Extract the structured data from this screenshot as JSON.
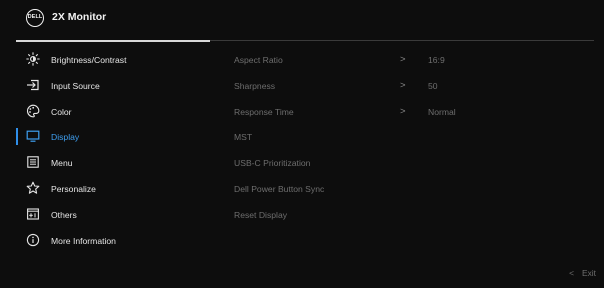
{
  "header": {
    "logo_text": "DELL",
    "title": "2X Monitor"
  },
  "menu": {
    "items": [
      {
        "label": "Brightness/Contrast",
        "icon": "brightness-icon"
      },
      {
        "label": "Input Source",
        "icon": "input-source-icon"
      },
      {
        "label": "Color",
        "icon": "color-palette-icon"
      },
      {
        "label": "Display",
        "icon": "display-monitor-icon",
        "active": true
      },
      {
        "label": "Menu",
        "icon": "menu-list-icon"
      },
      {
        "label": "Personalize",
        "icon": "star-icon"
      },
      {
        "label": "Others",
        "icon": "others-icon"
      },
      {
        "label": "More Information",
        "icon": "info-icon"
      }
    ]
  },
  "submenu": {
    "items": [
      {
        "label": "Aspect Ratio",
        "has_arrow": true,
        "value": "16:9"
      },
      {
        "label": "Sharpness",
        "has_arrow": true,
        "value": "50"
      },
      {
        "label": "Response Time",
        "has_arrow": true,
        "value": "Normal"
      },
      {
        "label": "MST"
      },
      {
        "label": "USB-C Prioritization"
      },
      {
        "label": "Dell Power Button Sync"
      },
      {
        "label": "Reset Display"
      }
    ],
    "arrow_glyph": ">"
  },
  "footer": {
    "exit_chevron": "<",
    "exit_label": "Exit"
  },
  "colors": {
    "background": "#0d0d0d",
    "active": "#3f9ff0",
    "text": "#e6e6e6",
    "disabled_text": "#6e6e6e"
  }
}
